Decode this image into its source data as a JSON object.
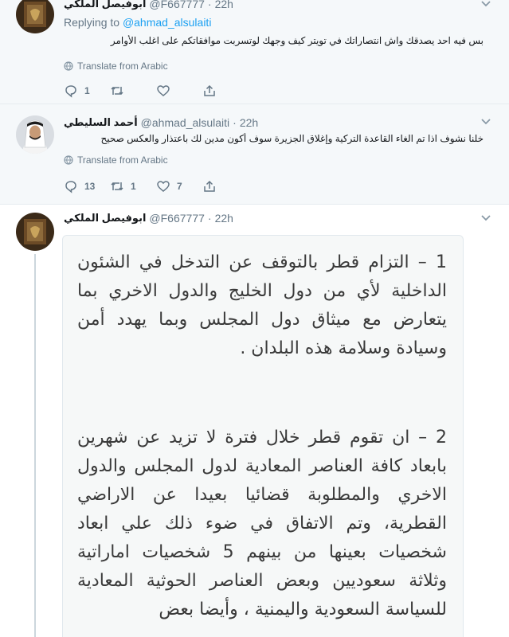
{
  "tweets": [
    {
      "name": "ابوفيصل الملكي",
      "handle": "@F667777",
      "time": "22h",
      "replying_label": "Replying to",
      "replying_to": "@ahmad_alsulaiti",
      "text": "بس فيه احد يصدقك واش انتصاراتك في تويتر كيف وجهك لوتسربت موافقاتكم على اغلب الأوامر",
      "translate": "Translate from Arabic",
      "reply_count": "1",
      "retweet_count": "",
      "like_count": ""
    },
    {
      "name": "أحمد السليطي",
      "handle": "@ahmad_alsulaiti",
      "time": "22h",
      "text": "خلنا نشوف اذا تم الغاء القاعدة التركية وإغلاق الجزيرة سوف أكون مدين لك باعتذار والعكس صحيح",
      "translate": "Translate from Arabic",
      "reply_count": "13",
      "retweet_count": "1",
      "like_count": "7"
    },
    {
      "name": "ابوفيصل الملكي",
      "handle": "@F667777",
      "time": "22h",
      "image_text": [
        "1 – التزام قطر بالتوقف عن التدخل في الشئون الداخلية لأي من دول الخليج والدول الاخري بما يتعارض مع ميثاق دول المجلس وبما يهدد أمن وسيادة وسلامة هذه البلدان .",
        "2 – ان تقوم قطر خلال فترة لا تزيد عن شهرين بابعاد كافة العناصر المعادية لدول المجلس والدول الاخري والمطلوبة قضائيا بعيدا عن الاراضي القطرية، وتم الاتفاق في ضوء ذلك علي ابعاد شخصيات بعينها من بينهم 5 شخصيات اماراتية وثلاثة سعوديين وبعض العناصر الحوثية المعادية للسياسة السعودية واليمنية ، وأيضا بعض"
      ]
    }
  ],
  "colors": {
    "accent": "#1da1f2",
    "muted": "#657786",
    "conversation_bg": "#f5f8fa",
    "border": "#e6ecf0"
  },
  "icons": [
    "caret-down-icon",
    "globe-icon",
    "reply-icon",
    "retweet-icon",
    "like-icon",
    "share-icon"
  ]
}
